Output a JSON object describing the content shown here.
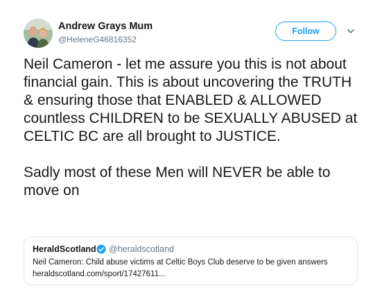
{
  "author": {
    "display_name": "Andrew Grays Mum",
    "handle": "@HeleneG46816352",
    "avatar_icon": "profile-photo"
  },
  "actions": {
    "follow_label": "Follow",
    "more_icon": "chevron-down-icon"
  },
  "tweet": {
    "paragraph_1": "Neil Cameron - let me assure you this is not about financial gain. This is about uncovering the TRUTH & ensuring those that ENABLED & ALLOWED countless CHILDREN to be SEXUALLY ABUSED at CELTIC BC are all brought to JUSTICE.",
    "paragraph_2": "Sadly most of these Men will NEVER be able to move on"
  },
  "quoted": {
    "name": "HeraldScotland",
    "handle": "@heraldscotland",
    "verified_icon": "verified-badge-icon",
    "headline": "Neil Cameron: Child abuse victims at Celtic Boys Club deserve to be given answers",
    "url": "heraldscotland.com/sport/17427611..."
  },
  "colors": {
    "accent": "#1da1f2",
    "secondary_text": "#657786",
    "border": "#e1e8ed"
  }
}
